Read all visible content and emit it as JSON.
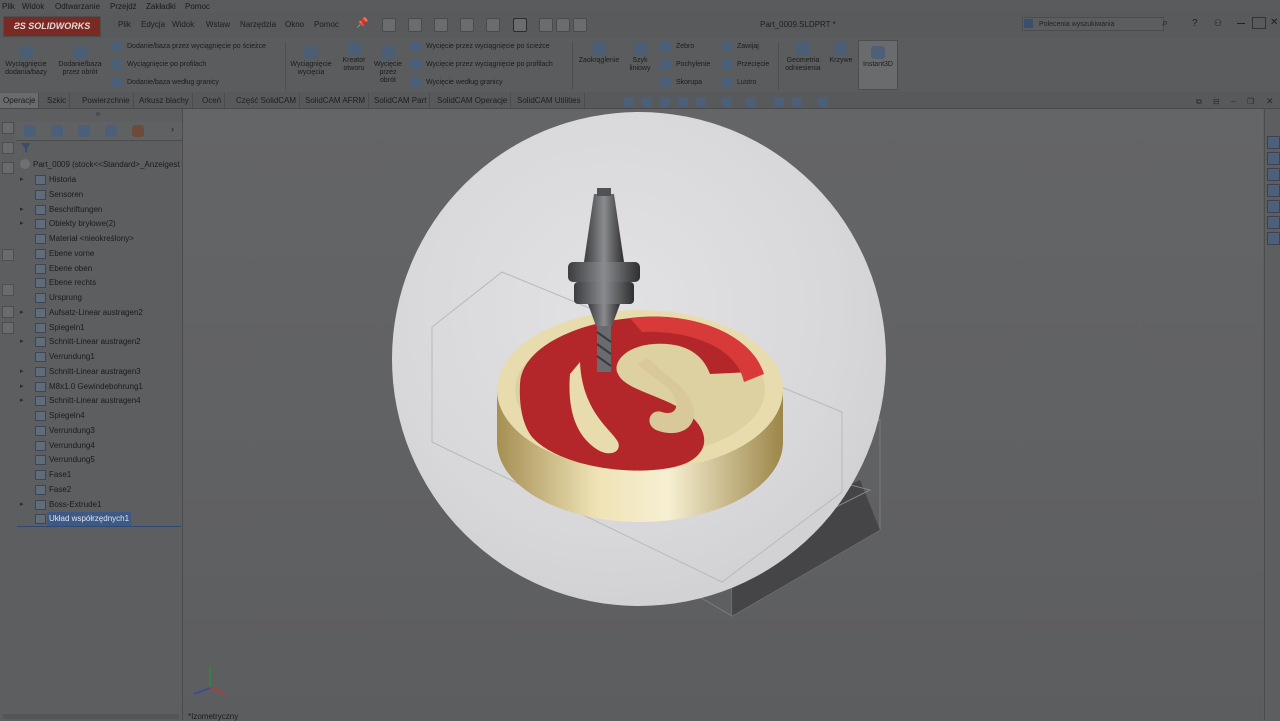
{
  "menubar": {
    "items": [
      "Plik",
      "Widok",
      "Odtwarzanie",
      "Przejdź",
      "Zakładki",
      "Pomoc"
    ]
  },
  "titlebar": {
    "logo_text": "SOLIDWORKS",
    "menu": [
      "Plik",
      "Edycja",
      "Widok",
      "Wstaw",
      "Narzędzia",
      "Okno",
      "Pomoc"
    ],
    "document_title": "Part_0009.SLDPRT *",
    "search_placeholder": "Polecenia wyszukiwania"
  },
  "ribbon": {
    "extrude_boss": "Wyciągnięcie dodania/bazy",
    "revolve_boss": "Dodanie/baza przez obrót",
    "swept_boss": "Dodanie/baza przez wyciągnięcie po ścieżce",
    "lofted_boss": "Wyciągnięcie po profilach",
    "boundary_boss": "Dodanie/baza według granicy",
    "extruded_cut": "Wyciągnięcie wycięcia",
    "hole_wizard": "Kreator otworu",
    "revolved_cut": "Wycięcie przez obrót",
    "swept_cut": "Wycięcie przez wyciągnięcie po ścieżce",
    "lofted_cut": "Wycięcie przez wyciągnięcie po profilach",
    "boundary_cut": "Wycięcie według granicy",
    "fillet": "Zaokrąglenie",
    "linear_pattern": "Szyk liniowy",
    "rib": "Żebro",
    "draft": "Pochylenie",
    "shell": "Skorupa",
    "wrap": "Zawijaj",
    "intersect": "Przecięcie",
    "mirror": "Lustro",
    "ref_geometry": "Geometria odniesienia",
    "curves": "Krzywe",
    "instant3d": "Instant3D"
  },
  "tabs": [
    "Operacje",
    "Szkic",
    "Powierzchnie",
    "Arkusz blachy",
    "Oceń",
    "Część SolidCAM",
    "SolidCAM AFRM",
    "SolidCAM Part",
    "SolidCAM Operacje",
    "SolidCAM Utilities"
  ],
  "tree": {
    "root": "Part_0009  (stock<<Standard>_Anzeigesta",
    "items": [
      {
        "label": "Historia",
        "expandable": true
      },
      {
        "label": "Sensoren",
        "expandable": false
      },
      {
        "label": "Beschriftungen",
        "expandable": true
      },
      {
        "label": "Obiekty bryłowe(2)",
        "expandable": true
      },
      {
        "label": "Materiał <nieokreślony>",
        "expandable": false
      },
      {
        "label": "Ebene vorne",
        "expandable": false
      },
      {
        "label": "Ebene oben",
        "expandable": false
      },
      {
        "label": "Ebene rechts",
        "expandable": false
      },
      {
        "label": "Ursprung",
        "expandable": false
      },
      {
        "label": "Aufsatz-Linear austragen2",
        "expandable": true
      },
      {
        "label": "Spiegeln1",
        "expandable": false
      },
      {
        "label": "Schnitt-Linear austragen2",
        "expandable": true
      },
      {
        "label": "Verrundung1",
        "expandable": false
      },
      {
        "label": "Schnitt-Linear austragen3",
        "expandable": true
      },
      {
        "label": "M8x1.0 Gewindebohrung1",
        "expandable": true
      },
      {
        "label": "Schnitt-Linear austragen4",
        "expandable": true
      },
      {
        "label": "Spiegeln4",
        "expandable": false
      },
      {
        "label": "Verrundung3",
        "expandable": false
      },
      {
        "label": "Verrundung4",
        "expandable": false
      },
      {
        "label": "Verrundung5",
        "expandable": false
      },
      {
        "label": "Fase1",
        "expandable": false
      },
      {
        "label": "Fase2",
        "expandable": false
      },
      {
        "label": "Boss-Extrude1",
        "expandable": true
      },
      {
        "label": "Układ współrzędnych1",
        "expandable": false,
        "selected": true
      }
    ]
  },
  "viewport": {
    "view_label": "*Izometryczny"
  },
  "colors": {
    "emblem_red": "#b3272a",
    "emblem_gold": "#e6d7a6",
    "overlay_circle": "#dcdcde",
    "ui_dim": "#5e5f61"
  }
}
